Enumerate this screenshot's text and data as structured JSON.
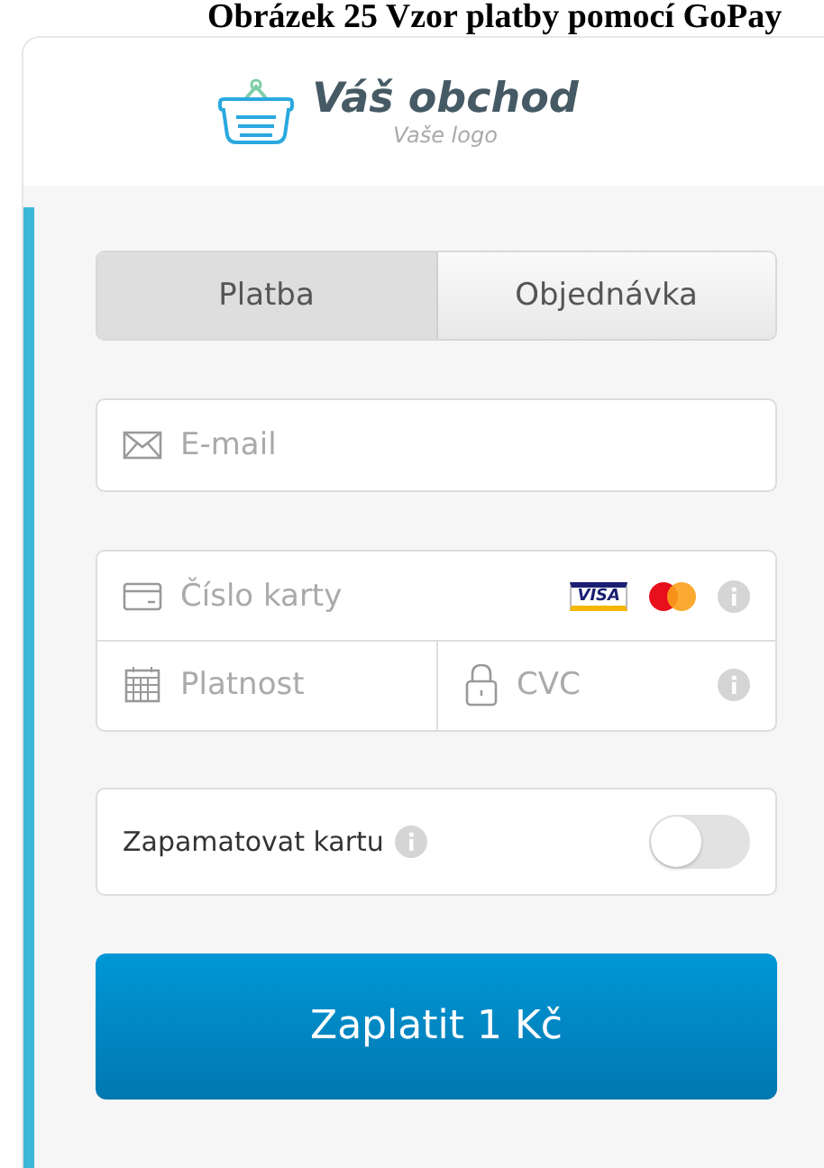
{
  "caption": "Obrázek 25 Vzor platby pomocí GoPay",
  "logo": {
    "title": "Váš obchod",
    "subtitle": "Vaše logo"
  },
  "tabs": [
    {
      "label": "Platba",
      "selected": true
    },
    {
      "label": "Objednávka",
      "selected": false
    }
  ],
  "email": {
    "placeholder": "E-mail"
  },
  "card_number": {
    "placeholder": "Číslo karty",
    "brand_label": "VISA"
  },
  "expiry": {
    "placeholder": "Platnost"
  },
  "cvc": {
    "placeholder": "CVC"
  },
  "remember": {
    "label": "Zapamatovat kartu",
    "on": false
  },
  "pay_button": "Zaplatit 1 Kč"
}
